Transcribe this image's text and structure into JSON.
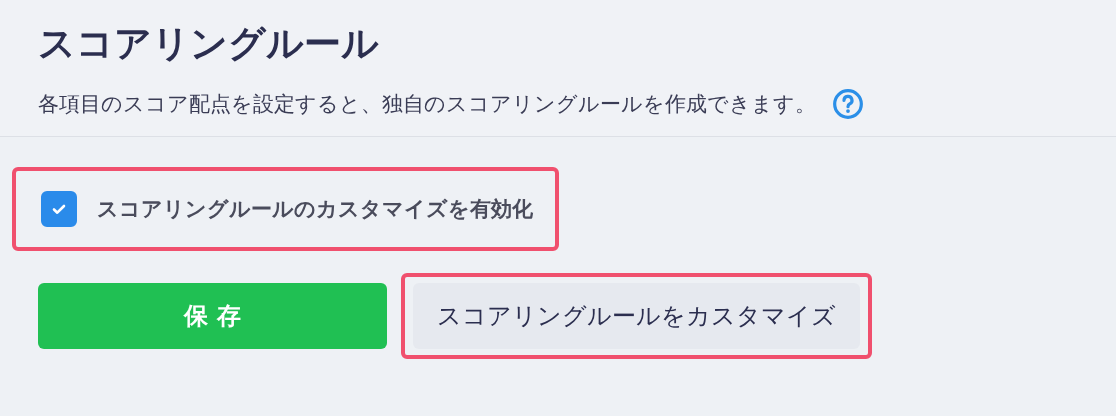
{
  "header": {
    "title": "スコアリングルール",
    "description": "各項目のスコア配点を設定すると、独自のスコアリングルールを作成できます。"
  },
  "customize_option": {
    "label": "スコアリングルールのカスタマイズを有効化",
    "checked": true,
    "highlighted": true
  },
  "buttons": [
    {
      "kind": "primary",
      "label": "保 存",
      "highlighted": false
    },
    {
      "kind": "secondary",
      "label": "スコアリングルールをカスタマイズ",
      "highlighted": true
    }
  ]
}
